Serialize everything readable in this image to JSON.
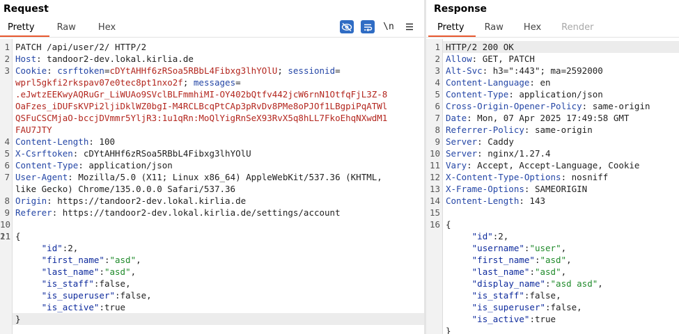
{
  "request": {
    "title": "Request",
    "tabs": [
      {
        "label": "Pretty",
        "active": true
      },
      {
        "label": "Raw",
        "active": false
      },
      {
        "label": "Hex",
        "active": false
      }
    ],
    "toolbar": {
      "icons": [
        "eye-off-icon",
        "word-wrap-icon",
        "newline-toggle-icon",
        "menu-icon"
      ],
      "newline_label": "\\n"
    },
    "line_numbers": [
      "1",
      "2",
      "3",
      "",
      "",
      "",
      "",
      "",
      "4",
      "5",
      "6",
      "7",
      "",
      "8",
      "9",
      "10",
      "11",
      "",
      "",
      "",
      "",
      "",
      "",
      ""
    ],
    "lines": {
      "l1": "PATCH /api/user/2/ HTTP/2",
      "l2_key": "Host",
      "l2_val": " tandoor2-dev.lokal.kirlia.de",
      "l3_key": "Cookie",
      "l3_c1k": "csrftoken",
      "l3_c1v": "cDYtAHHf6zRSoa5RBbL4Fibxg3lhYOlU",
      "l3_c2k": "sessionid",
      "l3_c2v_a": "wprl5gkfi2rkspav07e0tec8pt1nxo2f",
      "l3_c3k": "messages",
      "l3_c3v_a": ".eJwtzEEKwyAQRuGr_LiWUAo9SVclBLFmmhiMI-OY402bQtfv442jcW6rnN1OtfqFjL3Z-8",
      "l3_c3v_b": "OaFzes_iDUFsKVPi2ljiDklWZ0bgI-M4RCLBcqPtCAp3pRvDv8PMe8oPJOf1LBgpiPqATWl",
      "l3_c3v_c": "QSFuCSCMjaO-bccjDVmmr5YljR3:1u1qRn:MoQlYigRnSeX93RvX5q8hLL7FkoEhqNXwdM1",
      "l3_c3v_d": "FAU7JTY",
      "l4_key": "Content-Length",
      "l4_val": " 100",
      "l5_key": "X-Csrftoken",
      "l5_val": " cDYtAHHf6zRSoa5RBbL4Fibxg3lhYOlU",
      "l6_key": "Content-Type",
      "l6_val": " application/json",
      "l7_key": "User-Agent",
      "l7_val_a": " Mozilla/5.0 (X11; Linux x86_64) AppleWebKit/537.36 (KHTML,",
      "l7_val_b": "like Gecko) Chrome/135.0.0.0 Safari/537.36",
      "l8_key": "Origin",
      "l8_val": " https://tandoor2-dev.lokal.kirlia.de",
      "l9_key": "Referer",
      "l9_val": " https://tandoor2-dev.lokal.kirlia.de/settings/account",
      "body_open": "{",
      "body_close": "}"
    },
    "json_body": [
      {
        "key": "\"id\"",
        "value": "2,",
        "is_string": false
      },
      {
        "key": "\"first_name\"",
        "value": "\"asd\"",
        "tail": ",",
        "is_string": true
      },
      {
        "key": "\"last_name\"",
        "value": "\"asd\"",
        "tail": ",",
        "is_string": true
      },
      {
        "key": "\"is_staff\"",
        "value": "false,",
        "is_string": false
      },
      {
        "key": "\"is_superuser\"",
        "value": "false,",
        "is_string": false
      },
      {
        "key": "\"is_active\"",
        "value": "true",
        "is_string": false
      }
    ]
  },
  "response": {
    "title": "Response",
    "tabs": [
      {
        "label": "Pretty",
        "active": true
      },
      {
        "label": "Raw",
        "active": false
      },
      {
        "label": "Hex",
        "active": false
      },
      {
        "label": "Render",
        "active": false,
        "disabled": true
      }
    ],
    "line_numbers": [
      "1",
      "2",
      "3",
      "4",
      "5",
      "6",
      "7",
      "8",
      "9",
      "10",
      "11",
      "12",
      "13",
      "14",
      "15",
      "16",
      "",
      "",
      "",
      "",
      "",
      "",
      "",
      ""
    ],
    "status_line": "HTTP/2 200 OK",
    "headers": [
      {
        "key": "Allow",
        "value": " GET, PATCH"
      },
      {
        "key": "Alt-Svc",
        "value": " h3=\":443\"; ma=2592000"
      },
      {
        "key": "Content-Language",
        "value": " en"
      },
      {
        "key": "Content-Type",
        "value": " application/json"
      },
      {
        "key": "Cross-Origin-Opener-Policy",
        "value": " same-origin"
      },
      {
        "key": "Date",
        "value": " Mon, 07 Apr 2025 17:49:58 GMT"
      },
      {
        "key": "Referrer-Policy",
        "value": " same-origin"
      },
      {
        "key": "Server",
        "value": " Caddy"
      },
      {
        "key": "Server",
        "value": " nginx/1.27.4"
      },
      {
        "key": "Vary",
        "value": " Accept, Accept-Language, Cookie"
      },
      {
        "key": "X-Content-Type-Options",
        "value": " nosniff"
      },
      {
        "key": "X-Frame-Options",
        "value": " SAMEORIGIN"
      },
      {
        "key": "Content-Length",
        "value": " 143"
      }
    ],
    "body_open": "{",
    "body_close": "}",
    "json_body": [
      {
        "key": "\"id\"",
        "value": "2,",
        "is_string": false
      },
      {
        "key": "\"username\"",
        "value": "\"user\"",
        "tail": ",",
        "is_string": true
      },
      {
        "key": "\"first_name\"",
        "value": "\"asd\"",
        "tail": ",",
        "is_string": true
      },
      {
        "key": "\"last_name\"",
        "value": "\"asd\"",
        "tail": ",",
        "is_string": true
      },
      {
        "key": "\"display_name\"",
        "value": "\"asd asd\"",
        "tail": ",",
        "is_string": true
      },
      {
        "key": "\"is_staff\"",
        "value": "false,",
        "is_string": false
      },
      {
        "key": "\"is_superuser\"",
        "value": "false,",
        "is_string": false
      },
      {
        "key": "\"is_active\"",
        "value": "true",
        "is_string": false
      }
    ]
  },
  "colors": {
    "accent_tab_underline": "#e8582f",
    "header_key": "#2446a6",
    "cookie_value": "#b3261e",
    "json_key": "#0d2a9c",
    "json_string": "#1f8a2a",
    "toolbar_active": "#2f6cc4"
  }
}
